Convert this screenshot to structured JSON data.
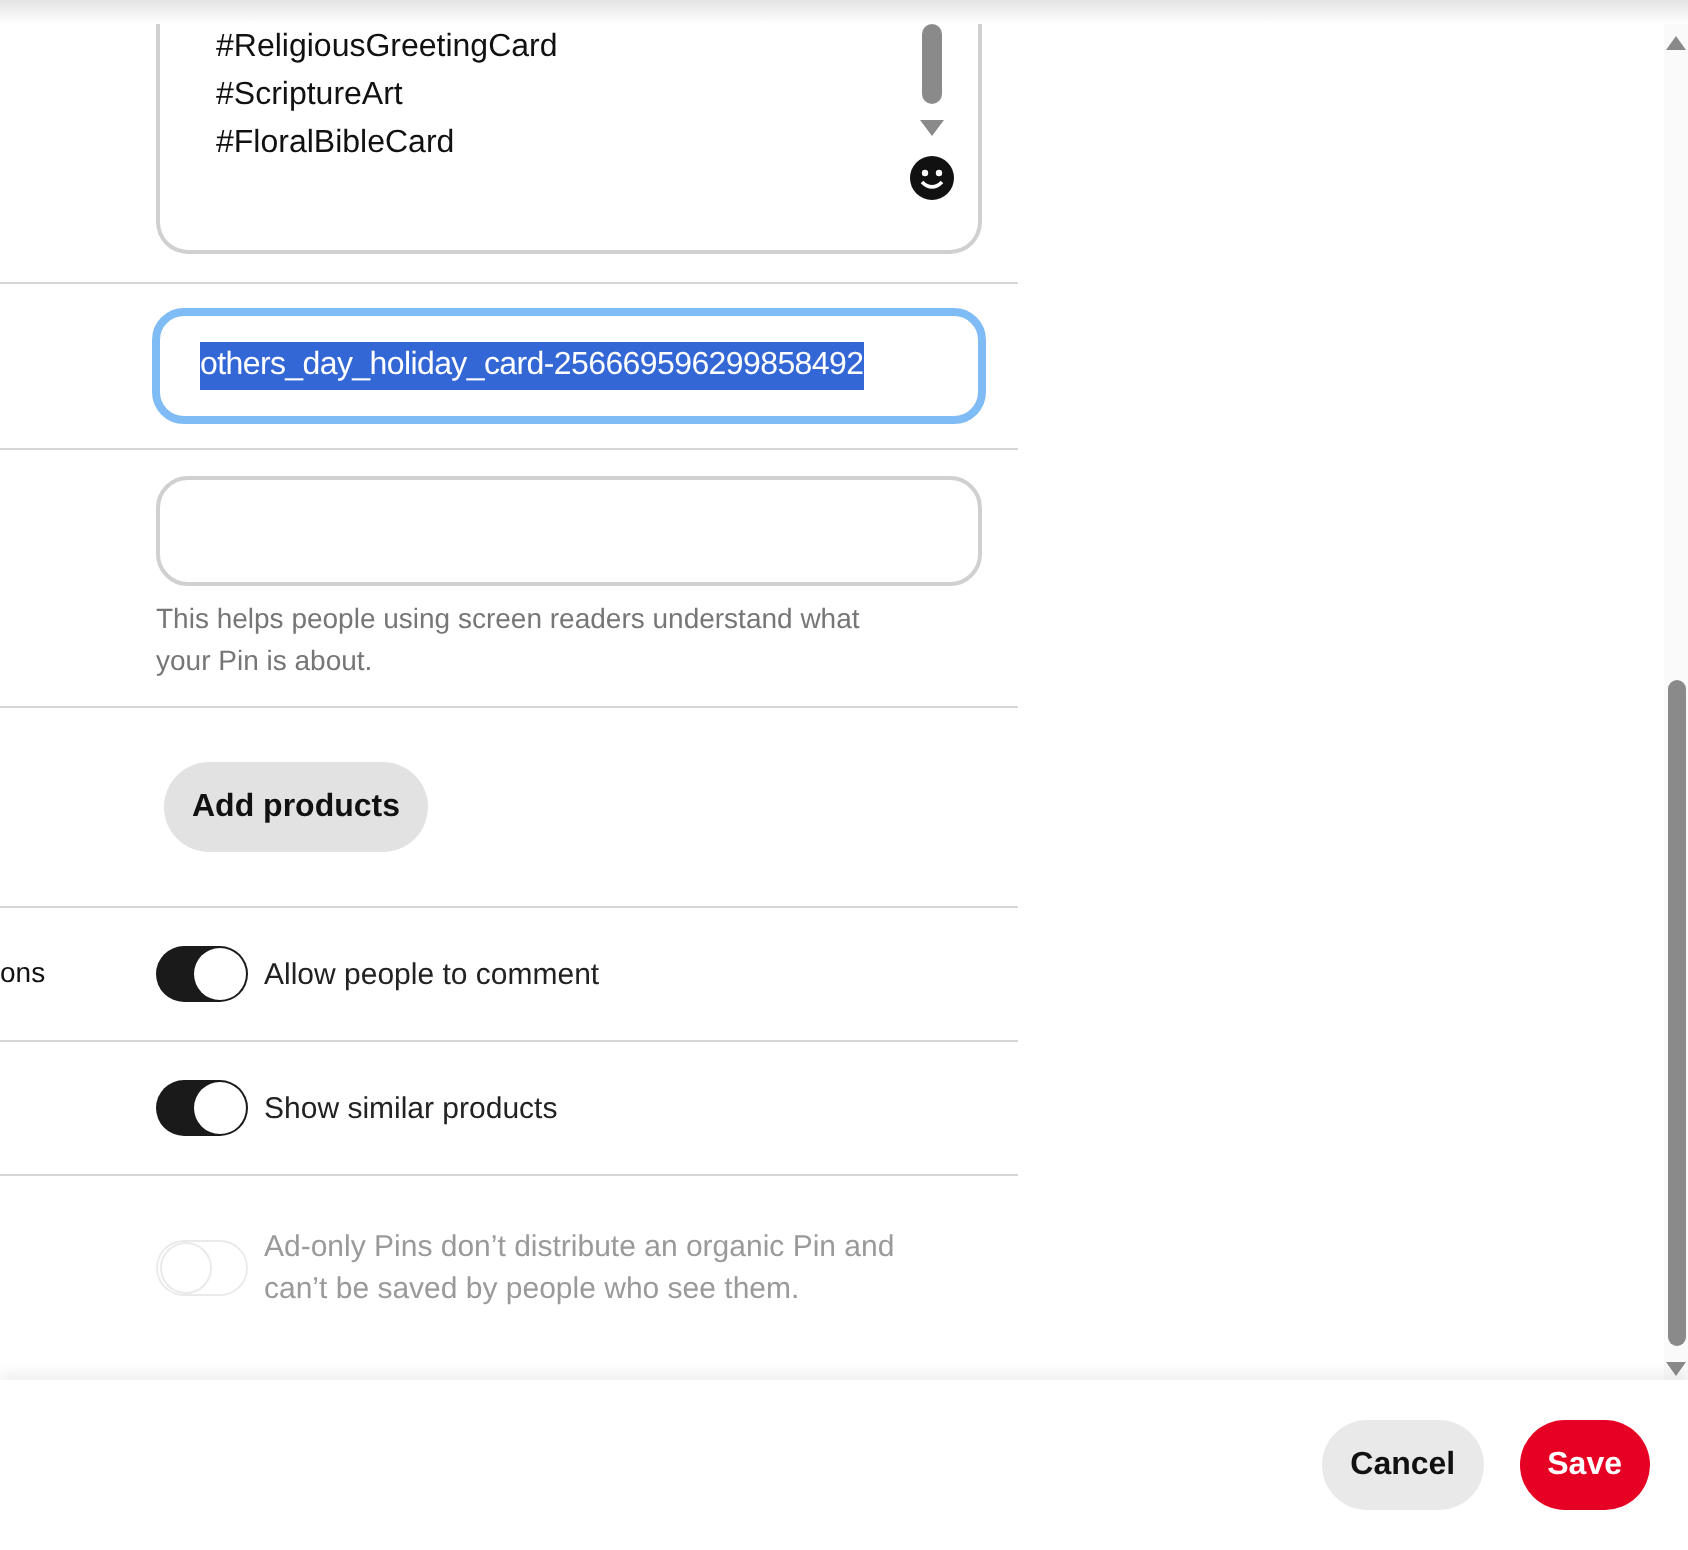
{
  "description": {
    "lines": [
      "#ReligiousGreetingCard",
      "#ScriptureArt",
      "#FloralBibleCard"
    ]
  },
  "link_field": {
    "value": "others_day_holiday_card-256669596299858492",
    "focused": true
  },
  "alt_text": {
    "help": "This helps people using screen readers understand what your Pin is about."
  },
  "products": {
    "button": "Add products"
  },
  "settings": [
    {
      "label": "ons",
      "text": "Allow people to comment",
      "on": true,
      "disabled": false
    },
    {
      "text": "Show similar products",
      "on": true,
      "disabled": false
    },
    {
      "text": "Ad-only Pins don’t distribute an organic Pin and can’t be saved by people who see them.",
      "on": false,
      "disabled": true
    }
  ],
  "footer": {
    "cancel": "Cancel",
    "save": "Save"
  }
}
